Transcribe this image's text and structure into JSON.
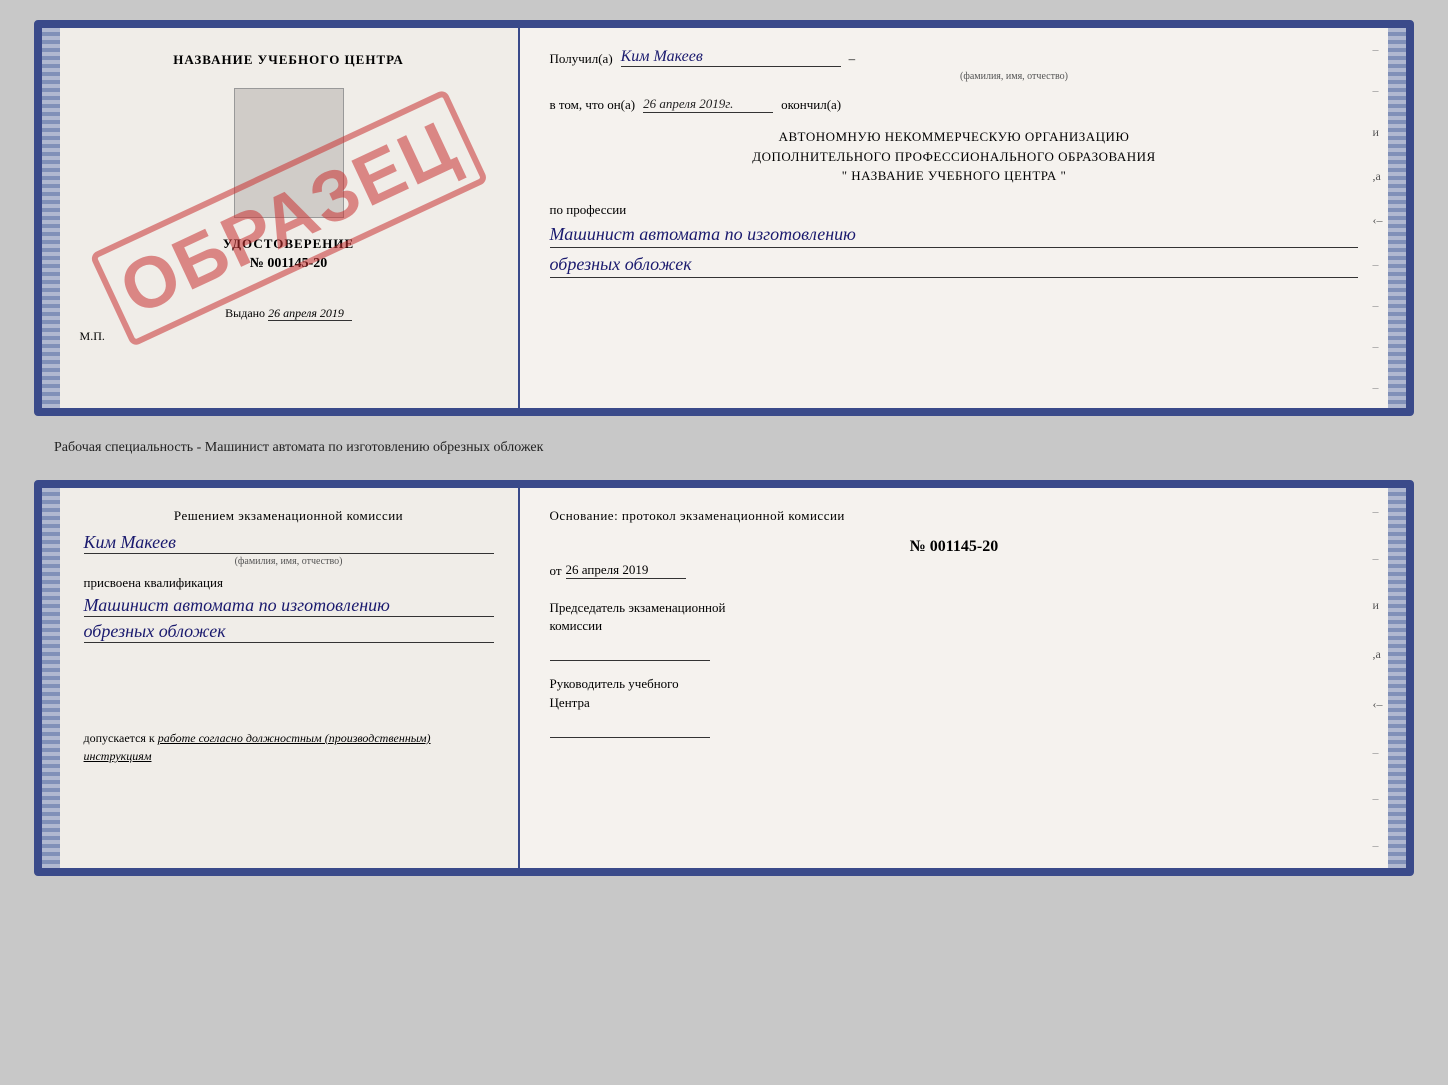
{
  "top_card": {
    "left": {
      "school_name": "НАЗВАНИЕ УЧЕБНОГО ЦЕНТРА",
      "udostoverenie_label": "УДОСТОВЕРЕНИЕ",
      "doc_number": "№ 001145-20",
      "vydano_prefix": "Выдано",
      "vydano_date": "26 апреля 2019",
      "mp_label": "М.П.",
      "stamp_text": "ОБРАЗЕЦ"
    },
    "right": {
      "poluchil_label": "Получил(а)",
      "recipient_name": "Ким Макеев",
      "dash": "–",
      "fio_hint": "(фамилия, имя, отчество)",
      "vtom_label": "в том, что он(а)",
      "vtom_date": "26 апреля 2019г.",
      "okoncil_label": "окончил(а)",
      "org_line1": "АВТОНОМНУЮ НЕКОММЕРЧЕСКУЮ ОРГАНИЗАЦИЮ",
      "org_line2": "ДОПОЛНИТЕЛЬНОГО ПРОФЕССИОНАЛЬНОГО ОБРАЗОВАНИЯ",
      "org_line3": "\" НАЗВАНИЕ УЧЕБНОГО ЦЕНТРА \"",
      "profession_label": "по профессии",
      "profession_line1": "Машинист автомата по изготовлению",
      "profession_line2": "обрезных обложек"
    }
  },
  "separator": {
    "text": "Рабочая специальность - Машинист автомата по изготовлению обрезных обложек"
  },
  "bottom_card": {
    "left": {
      "resheniem_label": "Решением экзаменационной комиссии",
      "komissia_name": "Ким Макеев",
      "fio_hint": "(фамилия, имя, отчество)",
      "prisvoena_label": "присвоена квалификация",
      "kvalif_line1": "Машинист автомата по изготовлению",
      "kvalif_line2": "обрезных обложек",
      "dopusk_prefix": "допускается к",
      "dopusk_italic": "работе согласно должностным (производственным) инструкциям"
    },
    "right": {
      "osnovanie_label": "Основание: протокол экзаменационной комиссии",
      "protocol_number": "№ 001145-20",
      "ot_label": "от",
      "ot_date": "26 апреля 2019",
      "chairman_label1": "Председатель экзаменационной",
      "chairman_label2": "комиссии",
      "rukovod_label1": "Руководитель учебного",
      "rukovod_label2": "Центра"
    }
  }
}
